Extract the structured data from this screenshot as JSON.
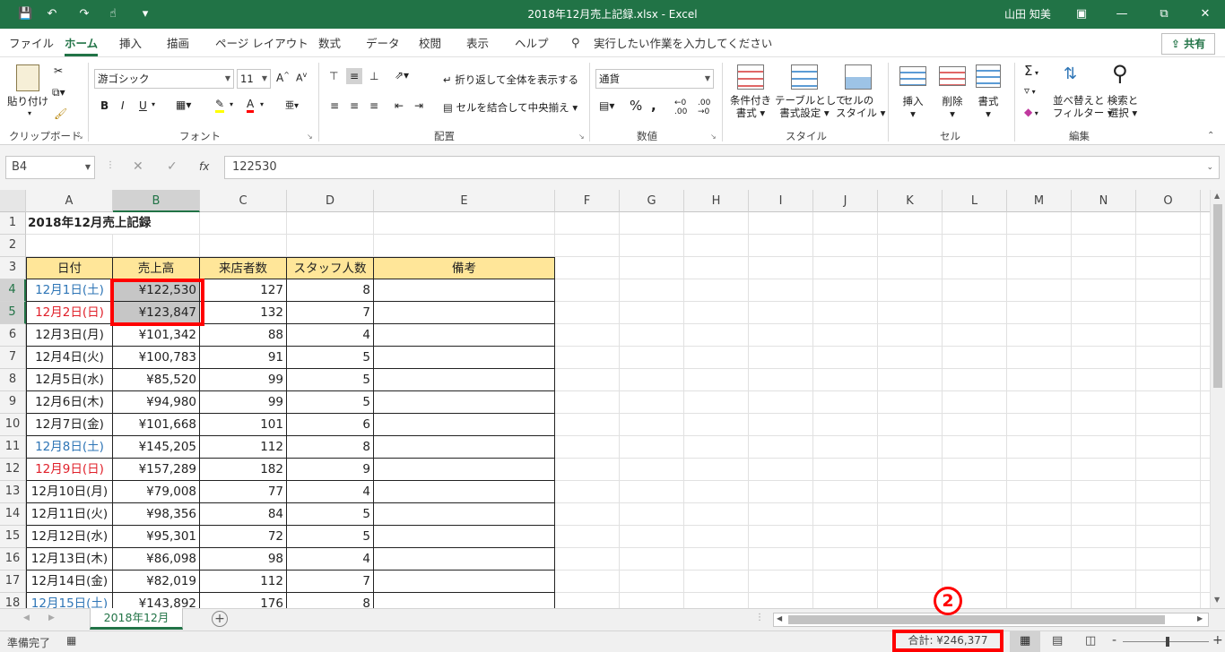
{
  "window": {
    "title": "2018年12月売上記録.xlsx  -  Excel",
    "user": "山田 知美"
  },
  "menu": {
    "items": [
      "ファイル",
      "ホーム",
      "挿入",
      "描画",
      "ページ レイアウト",
      "数式",
      "データ",
      "校閲",
      "表示",
      "ヘルプ"
    ],
    "active": "ホーム",
    "tell_me": "実行したい作業を入力してください",
    "share": "共有"
  },
  "ribbon": {
    "clipboard": {
      "label": "クリップボード",
      "paste": "貼り付け"
    },
    "font": {
      "label": "フォント",
      "name": "游ゴシック",
      "size": "11",
      "bold": "B",
      "italic": "I",
      "underline": "U"
    },
    "alignment": {
      "label": "配置",
      "wrap": "折り返して全体を表示する",
      "merge": "セルを結合して中央揃え"
    },
    "number": {
      "label": "数値",
      "format": "通貨"
    },
    "styles": {
      "label": "スタイル",
      "conditional": [
        "条件付き",
        "書式 ▾"
      ],
      "table": [
        "テーブルとして",
        "書式設定 ▾"
      ],
      "cell": [
        "セルの",
        "スタイル ▾"
      ]
    },
    "cells": {
      "label": "セル",
      "insert": "挿入",
      "delete": "削除",
      "format": "書式"
    },
    "editing": {
      "label": "編集",
      "sort": [
        "並べ替えと",
        "フィルター ▾"
      ],
      "find": [
        "検索と",
        "選択 ▾"
      ]
    }
  },
  "formula_bar": {
    "name_box": "B4",
    "content": "122530"
  },
  "columns": [
    "A",
    "B",
    "C",
    "D",
    "E",
    "F",
    "G",
    "H",
    "I",
    "J",
    "K",
    "L",
    "M",
    "N",
    "O"
  ],
  "sheet": {
    "title": "2018年12月売上記録",
    "headers": [
      "日付",
      "売上高",
      "来店者数",
      "スタッフ人数",
      "備考"
    ],
    "rows": [
      {
        "date": "12月1日(土)",
        "sales": "¥122,530",
        "visitors": "127",
        "staff": "8",
        "color": "#2e75b6"
      },
      {
        "date": "12月2日(日)",
        "sales": "¥123,847",
        "visitors": "132",
        "staff": "7",
        "color": "#e0202a"
      },
      {
        "date": "12月3日(月)",
        "sales": "¥101,342",
        "visitors": "88",
        "staff": "4",
        "color": "#222222"
      },
      {
        "date": "12月4日(火)",
        "sales": "¥100,783",
        "visitors": "91",
        "staff": "5",
        "color": "#222222"
      },
      {
        "date": "12月5日(水)",
        "sales": "¥85,520",
        "visitors": "99",
        "staff": "5",
        "color": "#222222"
      },
      {
        "date": "12月6日(木)",
        "sales": "¥94,980",
        "visitors": "99",
        "staff": "5",
        "color": "#222222"
      },
      {
        "date": "12月7日(金)",
        "sales": "¥101,668",
        "visitors": "101",
        "staff": "6",
        "color": "#222222"
      },
      {
        "date": "12月8日(土)",
        "sales": "¥145,205",
        "visitors": "112",
        "staff": "8",
        "color": "#2e75b6"
      },
      {
        "date": "12月9日(日)",
        "sales": "¥157,289",
        "visitors": "182",
        "staff": "9",
        "color": "#e0202a"
      },
      {
        "date": "12月10日(月)",
        "sales": "¥79,008",
        "visitors": "77",
        "staff": "4",
        "color": "#222222"
      },
      {
        "date": "12月11日(火)",
        "sales": "¥98,356",
        "visitors": "84",
        "staff": "5",
        "color": "#222222"
      },
      {
        "date": "12月12日(水)",
        "sales": "¥95,301",
        "visitors": "72",
        "staff": "5",
        "color": "#222222"
      },
      {
        "date": "12月13日(木)",
        "sales": "¥86,098",
        "visitors": "98",
        "staff": "4",
        "color": "#222222"
      },
      {
        "date": "12月14日(金)",
        "sales": "¥82,019",
        "visitors": "112",
        "staff": "7",
        "color": "#222222"
      },
      {
        "date": "12月15日(土)",
        "sales": "¥143,892",
        "visitors": "176",
        "staff": "8",
        "color": "#2e75b6"
      }
    ]
  },
  "sheet_tab": "2018年12月",
  "status": {
    "ready": "準備完了",
    "sum": "合計: ¥246,377"
  },
  "annotation": {
    "marker": "2",
    "highlight_color": "#ff0000"
  },
  "colors": {
    "accent": "#217346",
    "header_fill": "#ffe699",
    "selection": "#bfbfbf"
  }
}
